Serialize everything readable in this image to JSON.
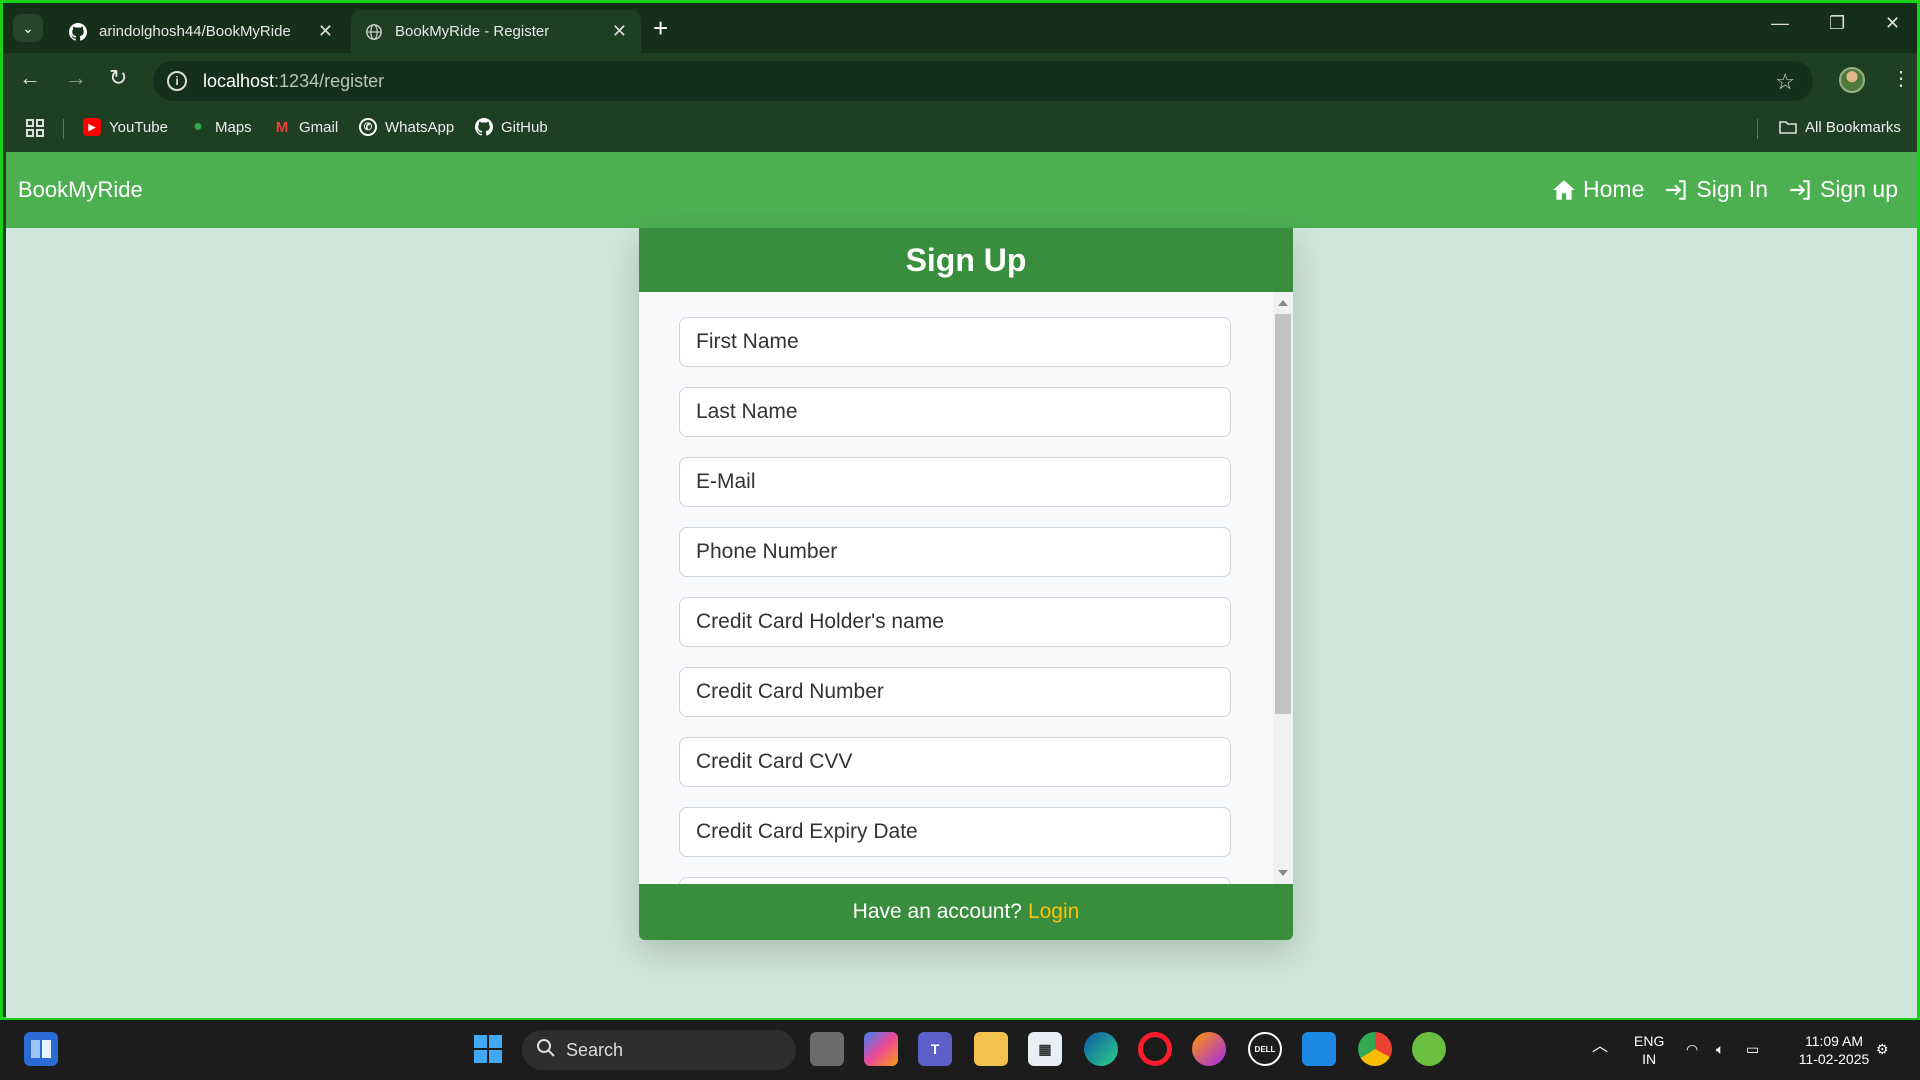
{
  "browser": {
    "tabs": [
      {
        "title": "arindolghosh44/BookMyRide",
        "active": false,
        "icon": "github-icon"
      },
      {
        "title": "BookMyRide - Register",
        "active": true,
        "icon": "globe-icon"
      }
    ],
    "url_host": "localhost",
    "url_path": ":1234/register",
    "bookmarks": [
      {
        "label": "YouTube",
        "icon": "youtube-icon"
      },
      {
        "label": "Maps",
        "icon": "maps-icon"
      },
      {
        "label": "Gmail",
        "icon": "gmail-icon"
      },
      {
        "label": "WhatsApp",
        "icon": "whatsapp-icon"
      },
      {
        "label": "GitHub",
        "icon": "github-icon"
      }
    ],
    "all_bookmarks": "All Bookmarks"
  },
  "app": {
    "brand": "BookMyRide",
    "nav": [
      {
        "label": "Home",
        "icon": "home-icon"
      },
      {
        "label": "Sign In",
        "icon": "sign-in-icon"
      },
      {
        "label": "Sign up",
        "icon": "sign-up-icon"
      }
    ],
    "colors": {
      "navbar": "#4caf50",
      "card_header": "#388e3c",
      "background": "#d0e6db",
      "link": "#ffc107"
    }
  },
  "form": {
    "title": "Sign Up",
    "fields": [
      {
        "placeholder": "First Name"
      },
      {
        "placeholder": "Last Name"
      },
      {
        "placeholder": "E-Mail"
      },
      {
        "placeholder": "Phone Number"
      },
      {
        "placeholder": "Credit Card Holder's name"
      },
      {
        "placeholder": "Credit Card Number"
      },
      {
        "placeholder": "Credit Card CVV"
      },
      {
        "placeholder": "Credit Card Expiry Date"
      }
    ],
    "footer_text": "Have an account?",
    "footer_link": "Login"
  },
  "taskbar": {
    "search_label": "Search",
    "lang_top": "ENG",
    "lang_bottom": "IN",
    "time": "11:09 AM",
    "date": "11-02-2025"
  }
}
